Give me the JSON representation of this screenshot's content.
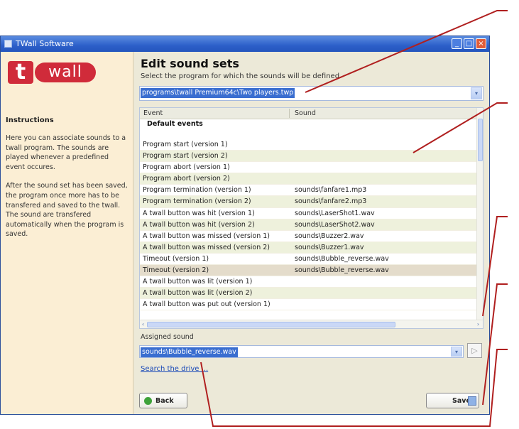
{
  "window": {
    "title": "TWall Software",
    "controls": [
      "_",
      "□",
      "×"
    ]
  },
  "sidebar": {
    "logo_t": "t",
    "logo_wall": "wall",
    "instructions_heading": "Instructions",
    "paragraphs": [
      "Here you can associate sounds to a twall program. The sounds are played whenever a predefined event occures.",
      "After the sound set has been saved, the program once more has to be transfered and saved to the twall. The sound are transfered automatically when the program is saved."
    ]
  },
  "main": {
    "title": "Edit sound sets",
    "subtitle": "Select the program for which the sounds will be defined.",
    "program_path": "programs\\twall Premium64c\\Two players.twp"
  },
  "grid": {
    "columns": [
      "Event",
      "Sound"
    ],
    "group": "Default events",
    "rows": [
      {
        "event": "Program start (version 1)",
        "sound": ""
      },
      {
        "event": "Program start (version 2)",
        "sound": ""
      },
      {
        "event": "Program abort (version 1)",
        "sound": ""
      },
      {
        "event": "Program abort (version 2)",
        "sound": ""
      },
      {
        "event": "Program termination (version 1)",
        "sound": "sounds\\fanfare1.mp3"
      },
      {
        "event": "Program termination (version 2)",
        "sound": "sounds\\fanfare2.mp3"
      },
      {
        "event": "A twall button was hit (version 1)",
        "sound": "sounds\\LaserShot1.wav"
      },
      {
        "event": "A twall button was hit (version 2)",
        "sound": "sounds\\LaserShot2.wav"
      },
      {
        "event": "A twall button was missed (version 1)",
        "sound": "sounds\\Buzzer2.wav"
      },
      {
        "event": "A twall button was missed (version 2)",
        "sound": "sounds\\Buzzer1.wav"
      },
      {
        "event": "Timeout (version 1)",
        "sound": "sounds\\Bubble_reverse.wav"
      },
      {
        "event": "Timeout (version 2)",
        "sound": "sounds\\Bubble_reverse.wav"
      },
      {
        "event": "A twall button was lit (version 1)",
        "sound": ""
      },
      {
        "event": "A twall button was lit (version 2)",
        "sound": ""
      },
      {
        "event": "A twall button was put out (version 1)",
        "sound": ""
      }
    ],
    "selected_index": 11
  },
  "assigned": {
    "label": "Assigned sound",
    "value": "sounds\\Bubble_reverse.wav",
    "search_link": "Search the drive ..."
  },
  "buttons": {
    "back": "Back",
    "save": "Save"
  },
  "icons": {
    "dropdown": "▾",
    "play": "▷",
    "scroll_left": "‹",
    "scroll_right": "›"
  },
  "colors": {
    "callout_line": "#b01f1f",
    "brand_red": "#d02b3a",
    "selection_blue": "#3a6ed0"
  }
}
